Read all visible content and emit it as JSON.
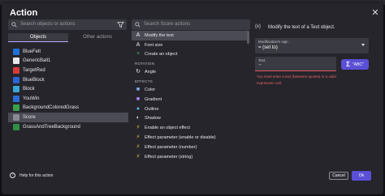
{
  "dialog": {
    "title": "Action",
    "close_icon": "close-icon"
  },
  "left": {
    "search_placeholder": "Search objects or actions",
    "tabs": [
      {
        "label": "Objects",
        "active": true
      },
      {
        "label": "Other actions",
        "active": false
      }
    ],
    "objects": [
      {
        "label": "BlueFelt",
        "color": "#1e6fd8"
      },
      {
        "label": "GenericBall1",
        "color": "#e8e8e8"
      },
      {
        "label": "TargetRed",
        "color": "#d83a3a"
      },
      {
        "label": "BlueBlock",
        "color": "#2c63d6"
      },
      {
        "label": "Block",
        "color": "#3aa5d8"
      },
      {
        "label": "YouWin",
        "color": "#2c6cd6"
      },
      {
        "label": "BackgroundColoredGrass",
        "color": "#3aa04a"
      },
      {
        "label": "Score",
        "color": "#8a8a94",
        "selected": true
      },
      {
        "label": "GrassAndTreeBackground",
        "color": "#2f8f45"
      }
    ]
  },
  "middle": {
    "search_placeholder": "Search Score actions",
    "items": [
      {
        "kind": "item",
        "label": "Modify the text",
        "icon": "text-icon",
        "glyph": "A",
        "color": "#e8e8ec",
        "selected": true
      },
      {
        "kind": "item",
        "label": "Font size",
        "icon": "font-size-icon",
        "glyph": "A",
        "color": "#e8e8ec"
      },
      {
        "kind": "item",
        "label": "Create an object",
        "icon": "create-object-icon",
        "glyph": "+",
        "color": "#5fc26a"
      },
      {
        "kind": "header",
        "label": "ROTATION"
      },
      {
        "kind": "item",
        "label": "Angle",
        "icon": "angle-icon",
        "glyph": "↻",
        "color": "#e8e8ec"
      },
      {
        "kind": "header",
        "label": "EFFECTS"
      },
      {
        "kind": "item",
        "label": "Color",
        "icon": "color-icon",
        "glyph": "■",
        "color": "#8ab8ff"
      },
      {
        "kind": "item",
        "label": "Gradient",
        "icon": "gradient-icon",
        "glyph": "■",
        "color": "#b48cff"
      },
      {
        "kind": "item",
        "label": "Outline",
        "icon": "outline-icon",
        "glyph": "●",
        "color": "#4fb8e8"
      },
      {
        "kind": "item",
        "label": "Shadow",
        "icon": "shadow-icon",
        "glyph": "◐",
        "color": "#d9d9de"
      },
      {
        "kind": "item",
        "label": "Enable an object effect",
        "icon": "effect-bolt-icon",
        "glyph": "⚡",
        "color": "#f2c230"
      },
      {
        "kind": "item",
        "label": "Effect parameter (enable or disable)",
        "icon": "effect-bolt-icon",
        "glyph": "⚡",
        "color": "#f2c230"
      },
      {
        "kind": "item",
        "label": "Effect parameter (number)",
        "icon": "effect-bolt-icon",
        "glyph": "⚡",
        "color": "#f2c230"
      },
      {
        "kind": "item",
        "label": "Effect parameter (string)",
        "icon": "effect-bolt-icon",
        "glyph": "⚡",
        "color": "#f2c230"
      }
    ]
  },
  "right": {
    "description_icon": "text-object-icon",
    "description": "Modify the text of a Text object.",
    "modification_sign": {
      "label": "Modification's sign",
      "value": "= (set to)"
    },
    "text_field": {
      "label": "Text",
      "value": "\"\"",
      "error": "You must enter a text (between quotes) or a valid expression call."
    },
    "sigma_button": {
      "glyph": "Σ",
      "label": "\"ABC\""
    }
  },
  "footer": {
    "help_label": "Help for this action",
    "cancel_label": "Cancel",
    "ok_label": "Ok"
  },
  "colors": {
    "accent": "#5b4fd6",
    "error": "#e86666",
    "panel": "#25252b"
  }
}
